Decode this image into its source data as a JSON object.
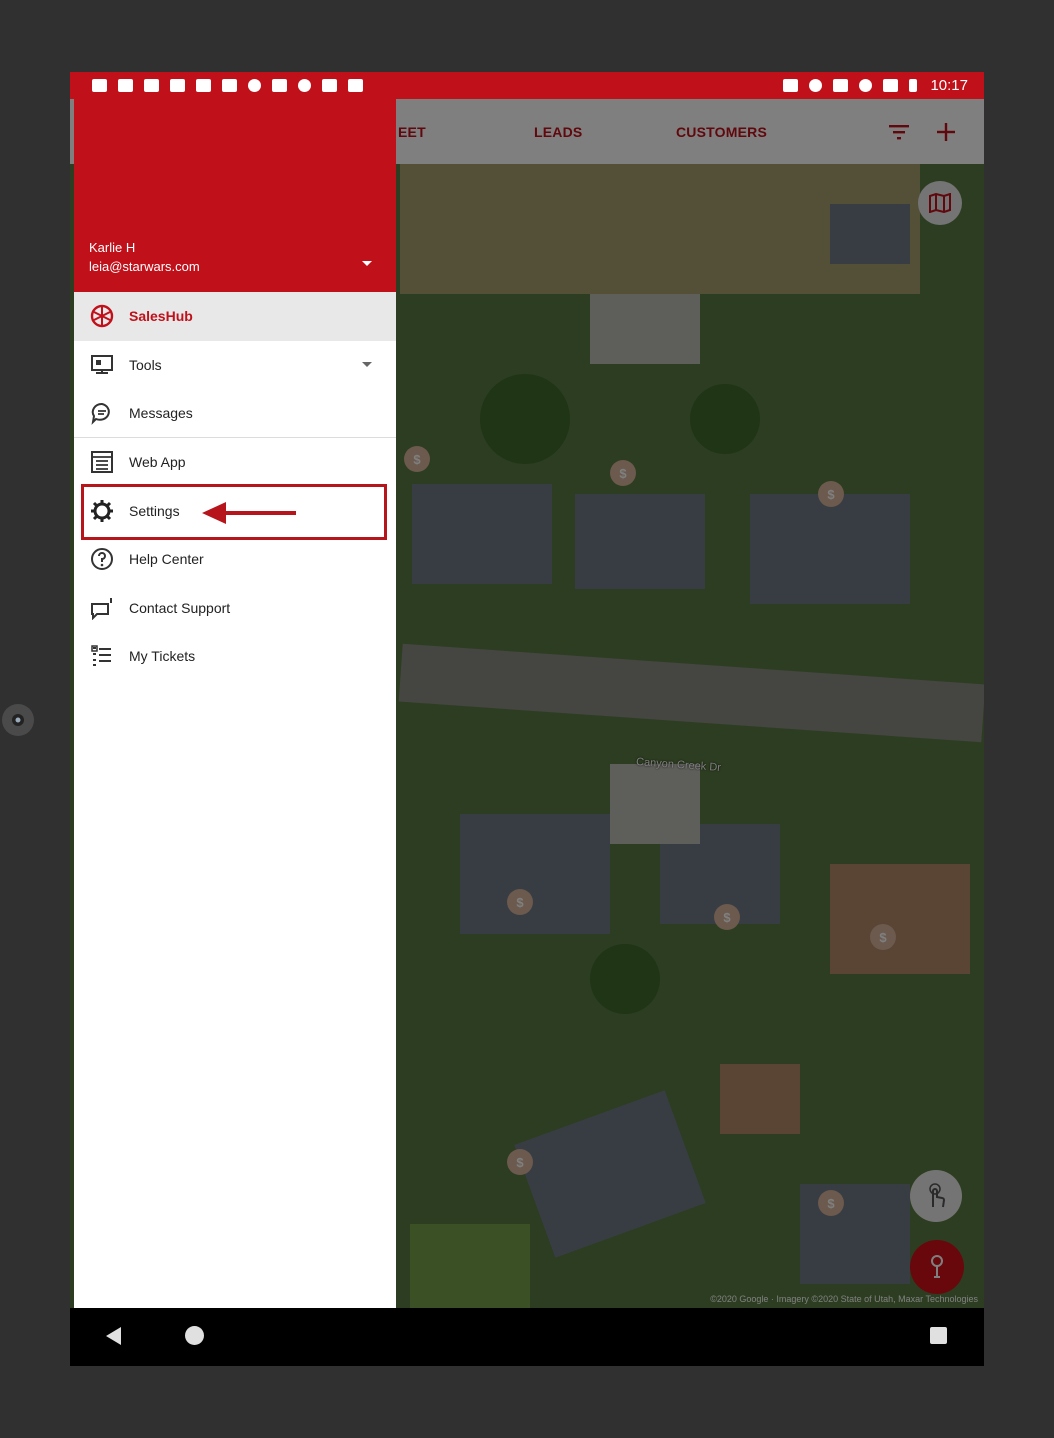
{
  "status_bar": {
    "time": "10:17"
  },
  "toolbar": {
    "tabs": [
      {
        "label": "EET"
      },
      {
        "label": "LEADS"
      },
      {
        "label": "CUSTOMERS"
      }
    ],
    "filter_icon": "filter-icon",
    "add_icon": "plus-icon"
  },
  "map": {
    "street_label": "Canyon Creek Dr",
    "attribution": "©2020 Google · Imagery ©2020 State of Utah, Maxar Technologies",
    "pin_symbol": "$"
  },
  "drawer": {
    "user_name": "Karlie H",
    "user_email": "leia@starwars.com",
    "items": [
      {
        "label": "SalesHub",
        "icon": "saleshub-icon",
        "active": true
      },
      {
        "label": "Tools",
        "icon": "tools-icon",
        "has_dropdown": true
      },
      {
        "label": "Messages",
        "icon": "messages-icon"
      },
      {
        "label": "Web App",
        "icon": "web-app-icon"
      },
      {
        "label": "Settings",
        "icon": "gear-icon"
      },
      {
        "label": "Help Center",
        "icon": "help-icon"
      },
      {
        "label": "Contact Support",
        "icon": "contact-support-icon"
      },
      {
        "label": "My Tickets",
        "icon": "tickets-icon"
      }
    ]
  },
  "colors": {
    "brand_red": "#c0101a",
    "annotation_red": "#b5151b",
    "backdrop": "#303030"
  }
}
